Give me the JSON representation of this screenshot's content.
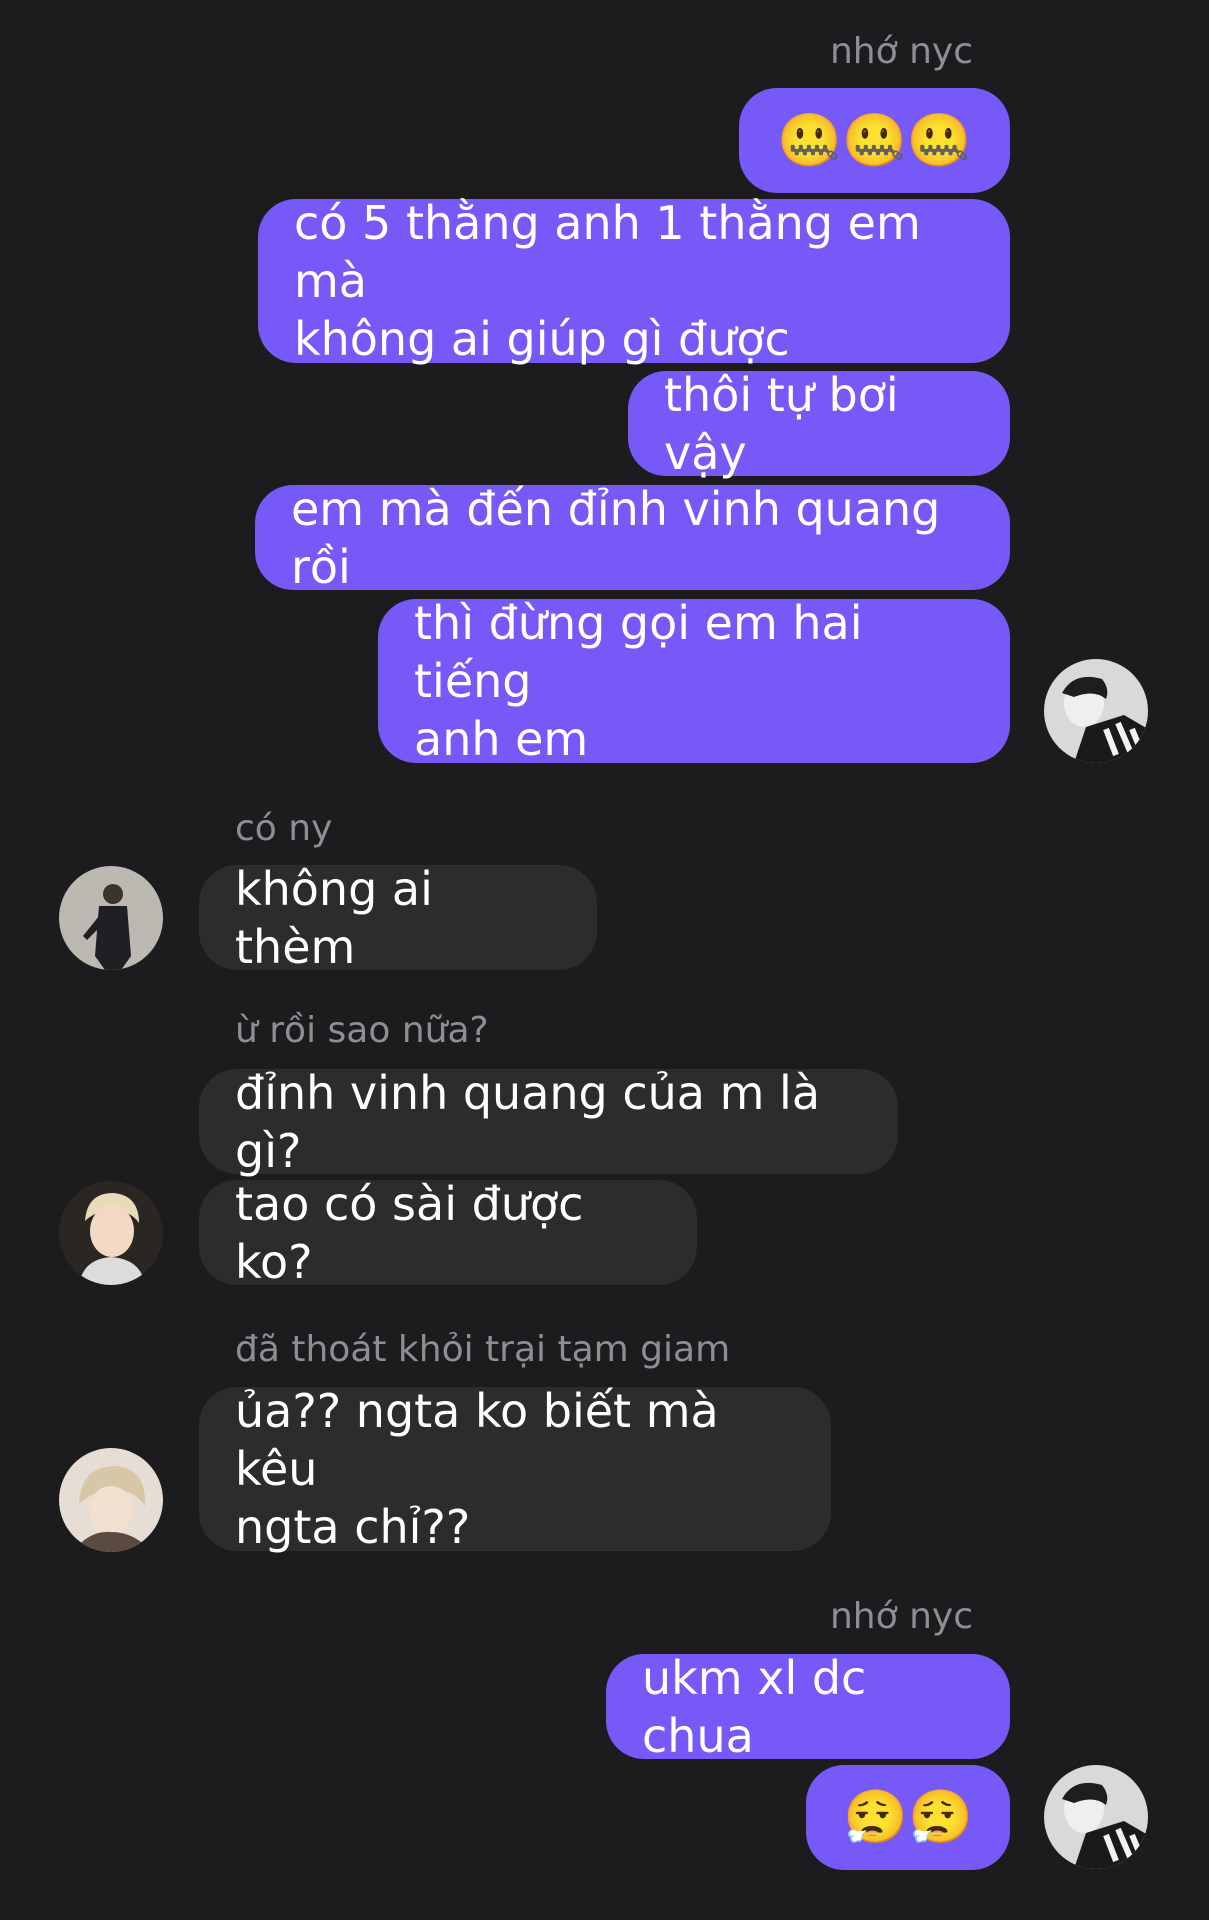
{
  "groups": [
    {
      "sender": "nhớ nyc",
      "messages": [
        "🤐🤐🤐",
        "có 5 thằng anh 1 thằng em mà\nkhông ai giúp gì được",
        "thôi tự bơi vậy",
        "em mà đến đỉnh vinh quang rồi",
        "thì đừng gọi em hai tiếng\nanh em"
      ]
    },
    {
      "sender": "có ny",
      "messages": [
        "không ai thèm"
      ]
    },
    {
      "sender": "ừ rồi sao nữa?",
      "messages": [
        "đỉnh vinh quang của m là gì?",
        "tao có sài được ko?"
      ]
    },
    {
      "sender": "đã thoát khỏi trại tạm giam",
      "messages": [
        "ủa?? ngta ko biết mà kêu\nngta chỉ??"
      ]
    },
    {
      "sender": "nhớ nyc",
      "messages": [
        "ukm xl dc chua",
        "😮‍💨😮‍💨"
      ]
    }
  ],
  "colors": {
    "background": "#1c1c1e",
    "outgoing_bubble": "#7659f6",
    "incoming_bubble": "#2c2c2e",
    "sender_name": "#8e8e93",
    "text": "#ffffff"
  },
  "icons": [
    "zipper-mouth-emoji",
    "face-exhaling-emoji",
    "avatar-photo"
  ]
}
